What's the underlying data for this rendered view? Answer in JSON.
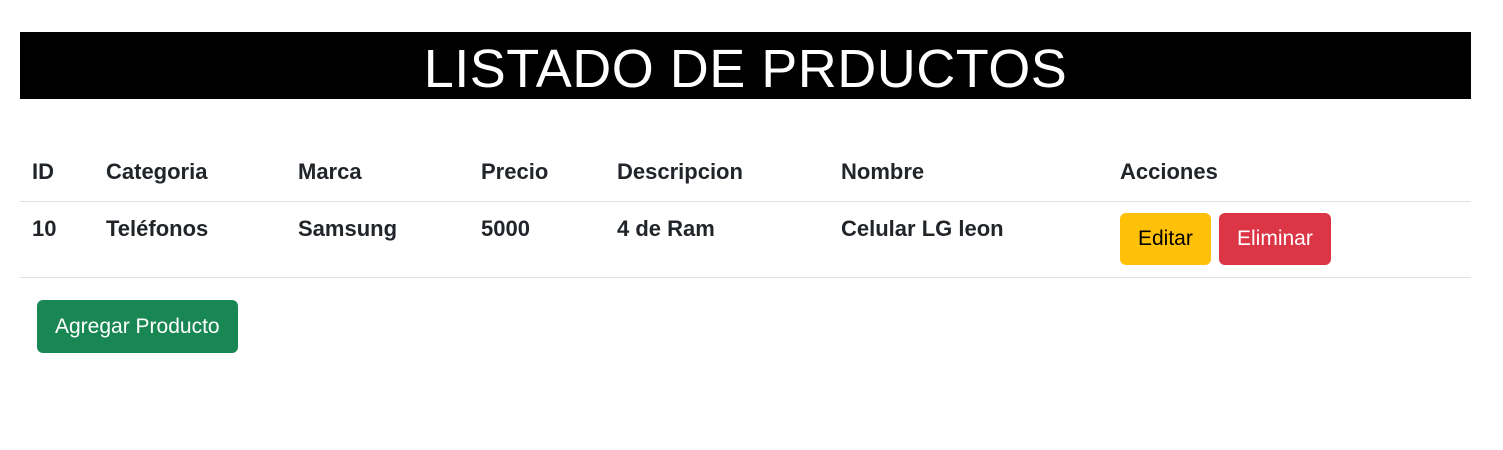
{
  "header": {
    "title": "LISTADO DE PRDUCTOS"
  },
  "table": {
    "columns": [
      "ID",
      "Categoria",
      "Marca",
      "Precio",
      "Descripcion",
      "Nombre",
      "Acciones"
    ],
    "rows": [
      {
        "id": "10",
        "categoria": "Teléfonos",
        "marca": "Samsung",
        "precio": "5000",
        "descripcion": "4 de Ram",
        "nombre": "Celular LG leon",
        "edit_label": "Editar",
        "delete_label": "Eliminar"
      }
    ]
  },
  "actions": {
    "add_label": "Agregar Producto"
  },
  "colors": {
    "title_bg": "#000000",
    "edit": "#ffc107",
    "delete": "#dc3545",
    "add": "#198754"
  }
}
